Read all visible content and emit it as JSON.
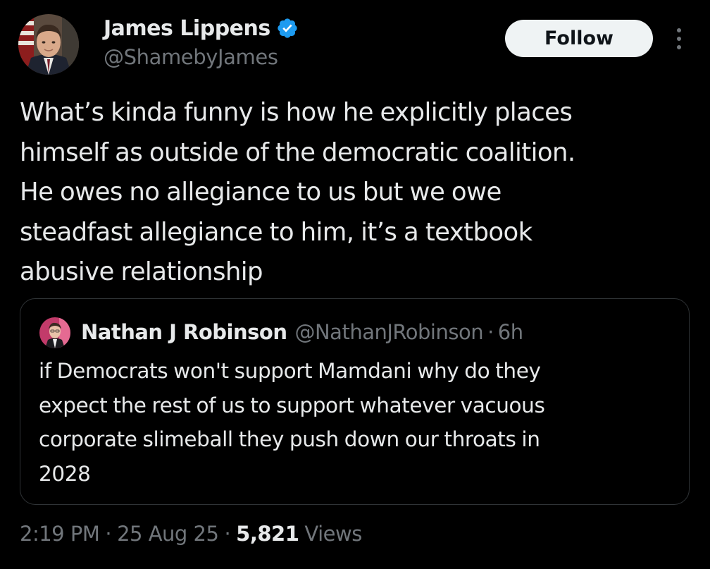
{
  "colors": {
    "background": "#000000",
    "primary_text": "#e7e9ea",
    "secondary_text": "#71767b",
    "verified_badge": "#1d9bf0",
    "follow_button_bg": "#eff3f4",
    "border": "#2f3336"
  },
  "author": {
    "display_name": "James Lippens",
    "handle": "@ShamebyJames",
    "verified": true,
    "verified_icon": "verified-badge-icon"
  },
  "actions": {
    "follow_label": "Follow",
    "more_icon": "more-vertical-icon"
  },
  "tweet": {
    "lines": [
      "What’s kinda funny is how he explicitly places",
      "himself as outside of the democratic coalition.",
      "He owes no allegiance to us but we owe",
      "steadfast allegiance to him, it’s a textbook",
      "abusive relationship"
    ]
  },
  "quote": {
    "display_name": "Nathan J Robinson",
    "handle": "@NathanJRobinson",
    "separator": "·",
    "time": "6h",
    "lines": [
      "if Democrats won't support Mamdani why do they",
      "expect the rest of us to support whatever vacuous",
      "corporate slimeball they push down our throats in",
      "2028"
    ]
  },
  "meta": {
    "time": "2:19 PM",
    "separator": "·",
    "date": "25 Aug 25",
    "view_count": "5,821",
    "views_label": "Views"
  }
}
